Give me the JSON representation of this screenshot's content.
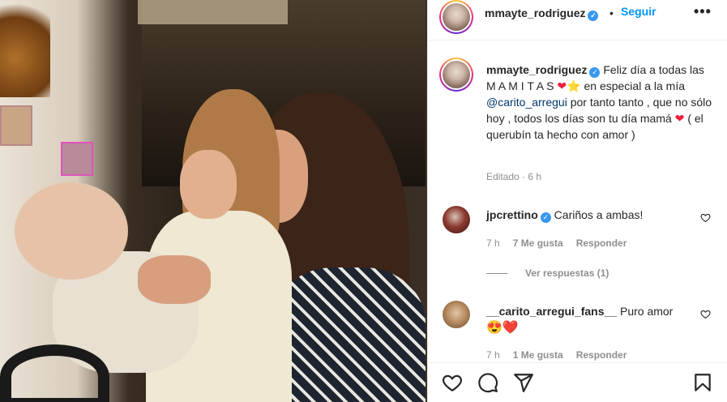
{
  "post": {
    "author": "mmayte_rodriguez",
    "follow_label": "Seguir",
    "header_separator": "•",
    "more_label": "•••"
  },
  "caption": {
    "author": "mmayte_rodriguez",
    "text_1": "Feliz día a todas las M A M I T A S",
    "text_2": "en especial a la mía",
    "mention": "@carito_arregui",
    "text_3": "por tanto tanto , que no sólo hoy , todos los días son tu día mamá",
    "text_4": "( el querubín ta hecho con amor )",
    "meta": "Editado · 6 h"
  },
  "comments": [
    {
      "author": "jpcrettino",
      "text": "Cariños a ambas!",
      "time": "7 h",
      "likes": "7 Me gusta",
      "reply_label": "Responder",
      "view_replies": "Ver respuestas (1)"
    },
    {
      "author": "__carito_arregui_fans__",
      "text": "Puro amor",
      "emojis": "😍❤️",
      "time": "7 h",
      "likes": "1 Me gusta",
      "reply_label": "Responder"
    }
  ],
  "icons": {
    "like": "heart-icon",
    "comment": "comment-icon",
    "share": "share-icon",
    "save": "bookmark-icon"
  },
  "colors": {
    "accent": "#0095f6",
    "verified": "#3897f0",
    "heart": "#ed1c3a",
    "muted": "#8e8e8e"
  }
}
